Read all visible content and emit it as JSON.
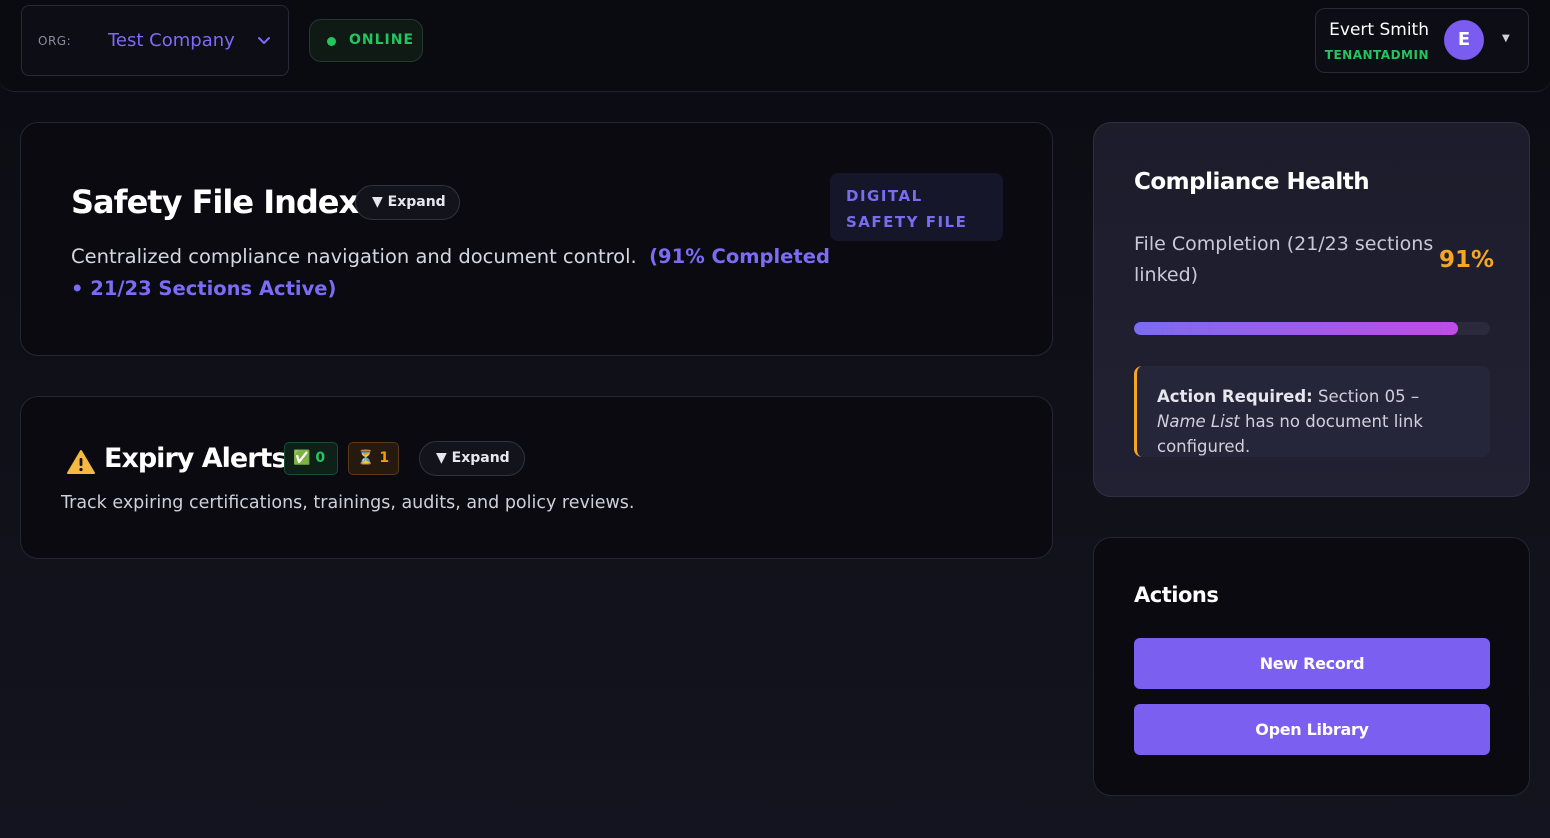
{
  "header": {
    "org_label": "ORG:",
    "org_name": "Test Company",
    "status": "ONLINE",
    "user_name": "Evert Smith",
    "user_role": "TENANTADMIN",
    "user_initial": "E"
  },
  "safety_file": {
    "title": "Safety File Index",
    "expand_label": "▼ Expand",
    "description": "Centralized compliance navigation and document control.",
    "completion_summary": "(91% Completed • 21/23 Sections Active)",
    "badge_line1": "DIGITAL",
    "badge_line2": "SAFETY FILE"
  },
  "expiry_alerts": {
    "title": "Expiry Alerts",
    "ok_icon": "✅",
    "ok_count": "0",
    "pending_icon": "⏳",
    "pending_count": "1",
    "expand_label": "▼ Expand",
    "description": "Track expiring certifications, trainings, audits, and policy reviews."
  },
  "compliance_health": {
    "title": "Compliance Health",
    "label": "File Completion (21/23 sections linked)",
    "percent_text": "91%",
    "progress": 0.91,
    "action_required_label": "Action Required:",
    "action_text_prefix": " Section 05 – ",
    "action_section_name": "Name List",
    "action_text_suffix": " has no document link configured."
  },
  "actions": {
    "title": "Actions",
    "new_record": "New Record",
    "open_library": "Open Library"
  },
  "colors": {
    "accent": "#7b5ff0",
    "online": "#22c55e",
    "warning": "#f5a623"
  }
}
